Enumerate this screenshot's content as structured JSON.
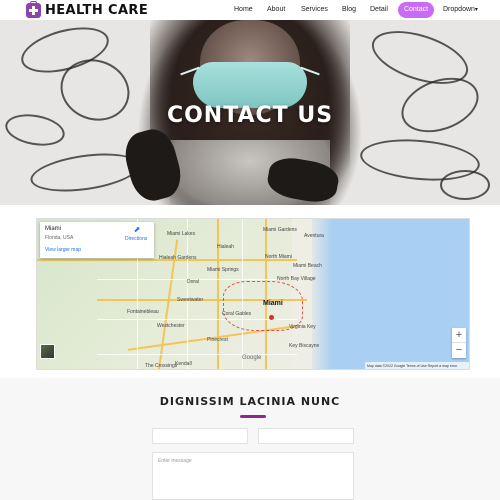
{
  "brand": {
    "name": "HEALTH CARE",
    "icon": "medical-kit-icon",
    "accent": "#8e44ad"
  },
  "nav": {
    "items": [
      {
        "label": "Home"
      },
      {
        "label": "About"
      },
      {
        "label": "Services"
      },
      {
        "label": "Blog"
      },
      {
        "label": "Detail"
      },
      {
        "label": "Contact",
        "active": true
      },
      {
        "label": "Dropdown"
      }
    ],
    "active_color": "#c86bf5"
  },
  "hero": {
    "title": "CONTACT US"
  },
  "map": {
    "place_title": "Miami",
    "place_subtitle": "Florida, USA",
    "directions_label": "Directions",
    "larger_map_label": "View larger map",
    "zoom_in": "+",
    "zoom_out": "−",
    "provider": "Google",
    "attribution": "Map data ©2022 Google   Terms of Use   Report a map error",
    "towns": [
      "Hialeah",
      "Miami Gardens",
      "North Miami",
      "Miami Lakes",
      "Hialeah Gardens",
      "Miami Beach",
      "Doral",
      "Miami Springs",
      "Sweetwater",
      "Fontainebleau",
      "Coral Gables",
      "Kendall",
      "Key Biscayne",
      "Westchester",
      "The Crossings",
      "Miami",
      "Aventura",
      "Virginia Key",
      "North Bay Village",
      "Pinecrest"
    ]
  },
  "contact": {
    "title": "DIGNISSIM LACINIA NUNC",
    "name_placeholder": "",
    "email_placeholder": "",
    "message_placeholder": "Enter message"
  }
}
